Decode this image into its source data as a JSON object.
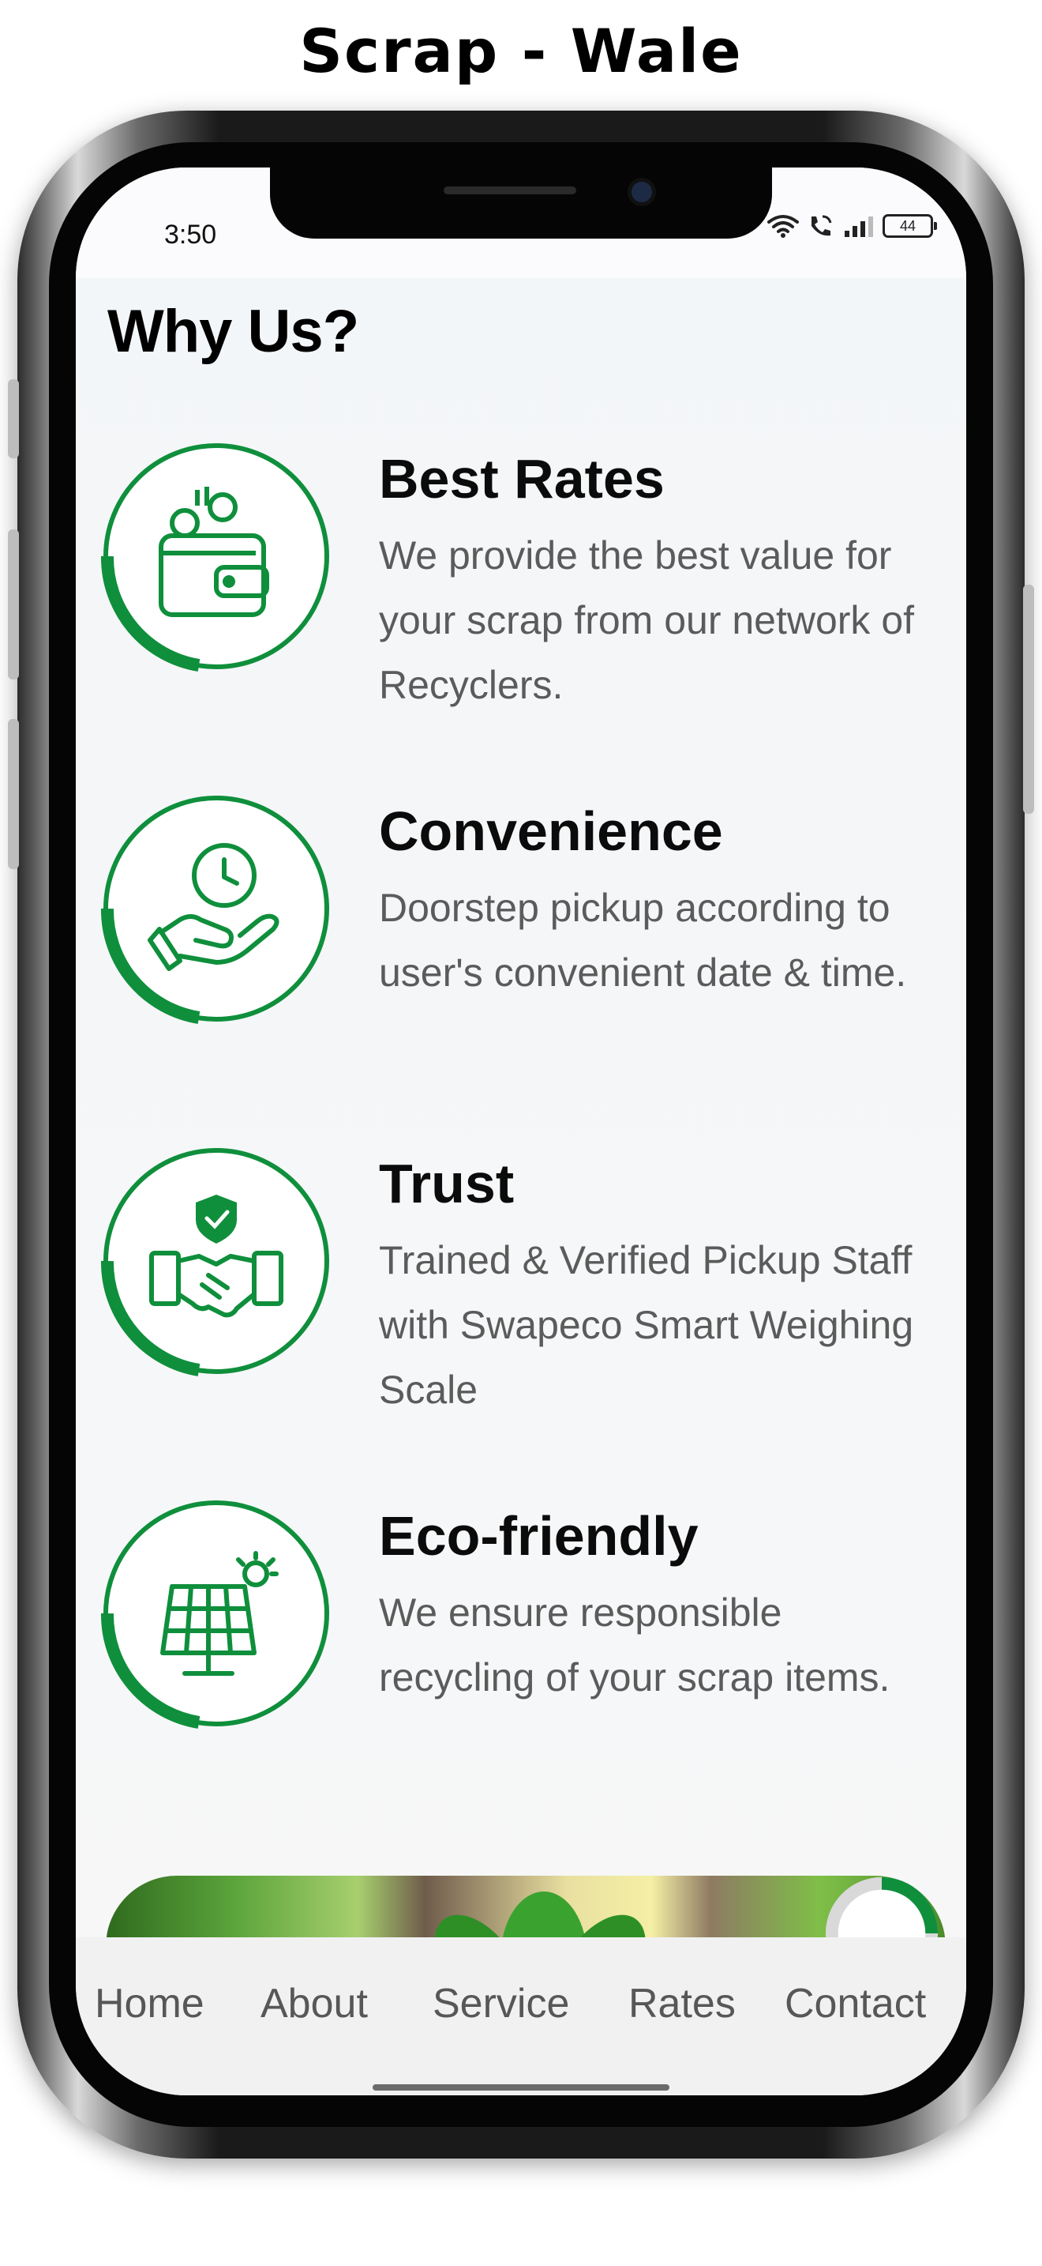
{
  "app_title": "Scrap - Wale",
  "status_bar": {
    "time": "3:50",
    "battery": "44"
  },
  "section": {
    "title": "Why Us?"
  },
  "features": [
    {
      "title": "Best Rates",
      "description": "We provide the best value for your scrap from our network of Recyclers.",
      "icon": "wallet-coins-icon"
    },
    {
      "title": "Convenience",
      "description": "Doorstep pickup according to user's convenient date & time.",
      "icon": "hand-clock-icon"
    },
    {
      "title": "Trust",
      "description": "Trained & Verified Pickup Staff with Swapeco Smart Weighing Scale",
      "icon": "handshake-shield-icon"
    },
    {
      "title": "Eco-friendly",
      "description": "We ensure responsible recycling of your scrap items.",
      "icon": "solar-panel-icon"
    }
  ],
  "bottom_nav": [
    {
      "label": "Home"
    },
    {
      "label": "About"
    },
    {
      "label": "Service"
    },
    {
      "label": "Rates"
    },
    {
      "label": "Contact"
    }
  ],
  "colors": {
    "accent_green": "#0f8f3c",
    "text_dark": "#0b0b0b",
    "text_muted": "#5b5b5b",
    "nav_bg": "#f1f1f1"
  }
}
